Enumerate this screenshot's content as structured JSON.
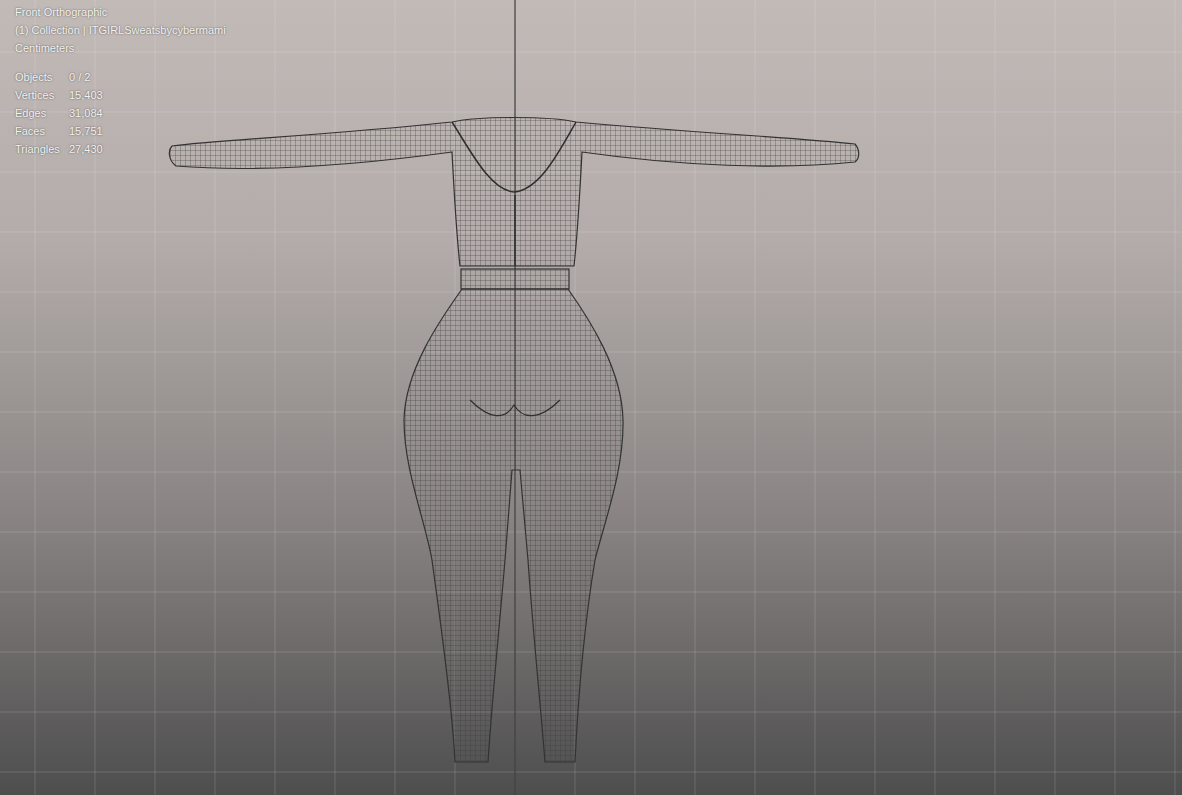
{
  "viewport": {
    "view": "Front Orthographic",
    "collection": "(1) Collection | ITGIRLSweatsbycybermami",
    "units": "Centimeters"
  },
  "stats": [
    {
      "label": "Objects",
      "value": "0 / 2"
    },
    {
      "label": "Vertices",
      "value": "15,403"
    },
    {
      "label": "Edges",
      "value": "31,084"
    },
    {
      "label": "Faces",
      "value": "15,751"
    },
    {
      "label": "Triangles",
      "value": "27,430"
    }
  ]
}
